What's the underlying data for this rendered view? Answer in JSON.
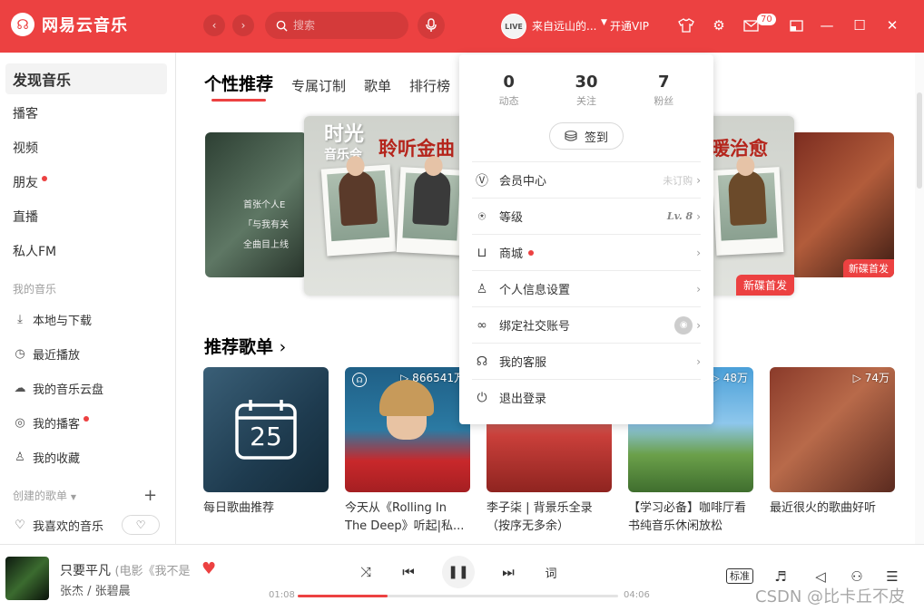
{
  "app": {
    "logo_mark": "☊",
    "title": "网易云音乐"
  },
  "header": {
    "search_placeholder": "搜索",
    "avatar_text": "LIVE",
    "username": "来自远山的...",
    "vip_label": "开通VIP",
    "mail_count": "70"
  },
  "sidebar": {
    "items": [
      {
        "label": "发现音乐"
      },
      {
        "label": "播客"
      },
      {
        "label": "视频"
      },
      {
        "label": "朋友"
      },
      {
        "label": "直播"
      },
      {
        "label": "私人FM"
      }
    ],
    "my_music_heading": "我的音乐",
    "my_music": [
      {
        "label": "本地与下载"
      },
      {
        "label": "最近播放"
      },
      {
        "label": "我的音乐云盘"
      },
      {
        "label": "我的播客"
      },
      {
        "label": "我的收藏"
      }
    ],
    "created_heading": "创建的歌单",
    "liked_label": "我喜欢的音乐"
  },
  "tabs": [
    "个性推荐",
    "专属订制",
    "歌单",
    "排行榜"
  ],
  "banners": {
    "left_text_1": "首张个人E",
    "left_text_2": "「与我有关",
    "left_text_3": "全曲目上线",
    "center_brand_1": "时光",
    "center_brand_2": "音乐会",
    "center_title": "聆听金曲",
    "center_title2": "暖治愈",
    "center_tag": "新碟首发",
    "right_tag": "新碟首发"
  },
  "recommend": {
    "title": "推荐歌单",
    "calendar_day": "25",
    "cards": [
      {
        "title": "每日歌曲推荐",
        "count": ""
      },
      {
        "title": "今天从《Rolling In The Deep》听起|私...",
        "count": "▷ 866541万"
      },
      {
        "title": "李子柒 | 背景乐全录（按序无多余）",
        "count": ""
      },
      {
        "title": "【学习必备】咖啡厅看书纯音乐休闲放松",
        "count": "▷ 48万"
      },
      {
        "title": "最近很火的歌曲好听",
        "count": "▷ 74万"
      }
    ]
  },
  "dropdown": {
    "stats": [
      {
        "num": "0",
        "label": "动态"
      },
      {
        "num": "30",
        "label": "关注"
      },
      {
        "num": "7",
        "label": "粉丝"
      }
    ],
    "checkin": "签到",
    "menu": {
      "member": "会员中心",
      "member_status": "未订购",
      "level": "等级",
      "level_value": "Lv. 8",
      "store": "商城",
      "profile": "个人信息设置",
      "social": "绑定社交账号",
      "service": "我的客服",
      "logout": "退出登录"
    }
  },
  "player": {
    "song": "只要平凡",
    "song_sub": "(电影《我不是",
    "artist": "张杰 / 张碧晨",
    "time_current": "01:08",
    "time_total": "04:06",
    "progress": 0.28,
    "quality": "标准",
    "lyrics_label": "词"
  },
  "watermark": "CSDN @比卡丘不皮",
  "colors": {
    "accent": "#ec4141"
  }
}
